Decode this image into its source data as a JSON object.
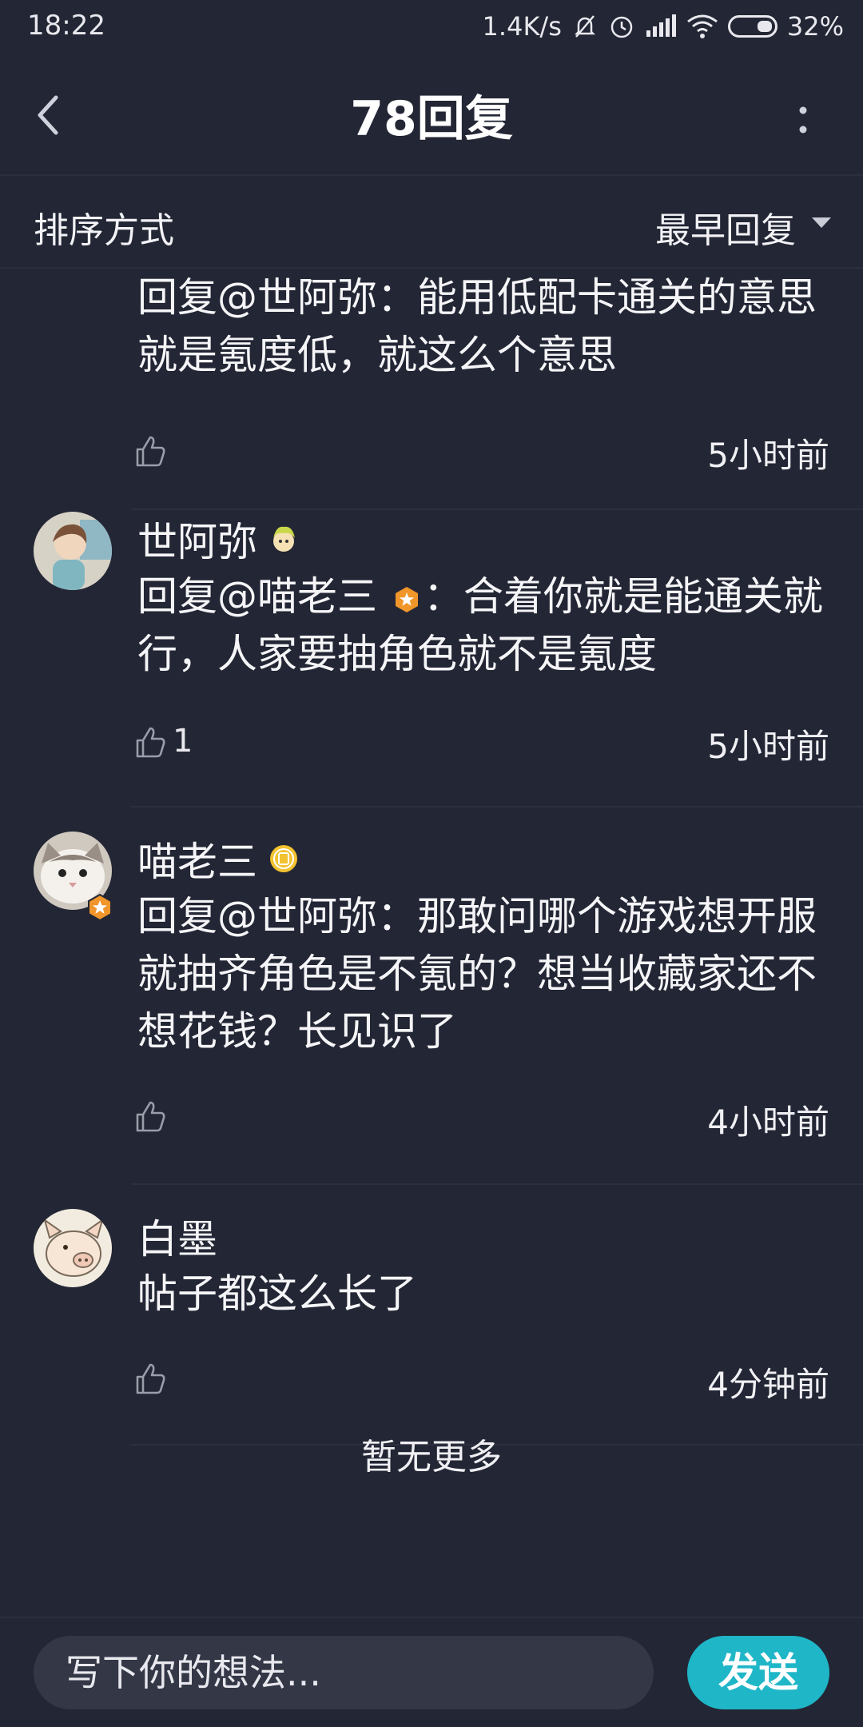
{
  "status_bar": {
    "time": "18:22",
    "net_speed": "1.4K/s",
    "battery": "32%"
  },
  "nav": {
    "title": "78回复"
  },
  "sort": {
    "label": "排序方式",
    "value": "最早回复"
  },
  "comments": [
    {
      "id": "c0",
      "body": "回复@世阿弥：能用低配卡通关的意思就是氪度低，就这么个意思",
      "likes": "",
      "time": "5小时前"
    },
    {
      "id": "c1",
      "user": "世阿弥",
      "body_prefix": "回复@喵老三",
      "body_suffix": "：合着你就是能通关就行，人家要抽角色就不是氪度",
      "likes": "1",
      "time": "5小时前"
    },
    {
      "id": "c2",
      "user": "喵老三",
      "body": "回复@世阿弥：那敢问哪个游戏想开服就抽齐角色是不氪的？想当收藏家还不想花钱？长见识了",
      "likes": "",
      "time": "4小时前"
    },
    {
      "id": "c3",
      "user": "白墨",
      "body": "帖子都这么长了",
      "likes": "",
      "time": "4分钟前"
    }
  ],
  "no_more": "暂无更多",
  "composer": {
    "placeholder": "写下你的想法...",
    "send_label": "发送"
  },
  "colors": {
    "background": "#232634",
    "accent": "#1fb6c8",
    "badge_orange": "#f0962a"
  }
}
